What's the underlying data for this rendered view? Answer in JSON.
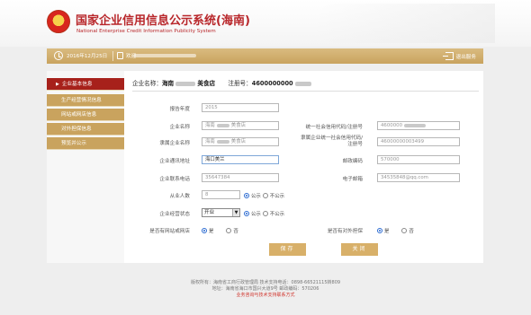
{
  "header": {
    "title_cn": "国家企业信用信息公示系统(海南)",
    "title_en": "National Enterprise Credit Information Publicity System"
  },
  "topbar": {
    "date": "2016年12月25日",
    "user_prefix": "欢迎",
    "logout_label": "退出服务"
  },
  "sidebar": {
    "items": [
      {
        "label": "企业基本信息",
        "active": true
      },
      {
        "label": "生产经营情况信息",
        "active": false
      },
      {
        "label": "网站或网店信息",
        "active": false
      },
      {
        "label": "对外担保信息",
        "active": false
      },
      {
        "label": "预览并公示",
        "active": false
      }
    ]
  },
  "company": {
    "name_label": "企业名称：",
    "name_value": "海南",
    "name_suffix": "美食店",
    "reg_label": "注册号：",
    "reg_value": "4600000000"
  },
  "form": {
    "report_year_label": "报告年度",
    "report_year_value": "2015",
    "ent_name_label": "企业名称",
    "ent_name_value": "海南",
    "ent_name_suffix": "美食店",
    "credit_code_label": "统一社会信用代码/注册号",
    "credit_code_value": "4600000",
    "affiliated_name_label": "隶属企业名称",
    "affiliated_name_value": "海南",
    "affiliated_name_suffix": "美食店",
    "affiliated_code_label": "隶属企业统一社会信用代码/注册号",
    "affiliated_code_value": "4600000000",
    "affiliated_code_suffix": "3499",
    "address_label": "企业通讯地址",
    "address_value": "海口美兰",
    "postcode_label": "邮政编码",
    "postcode_value": "570000",
    "phone_label": "企业联系电话",
    "phone_value": "35647384",
    "email_label": "电子邮箱",
    "email_value": "34535848@qq.com",
    "employees_label": "从业人数",
    "employees_value": "8",
    "publish_label": "公示",
    "nopublish_label": "不公示",
    "status_label": "企业经营状态",
    "status_value": "开业",
    "website_label": "是否有网站或网店",
    "guarantee_label": "是否有对外担保",
    "yes_label": "是",
    "no_label": "否",
    "save_label": "保存",
    "close_label": "关闭"
  },
  "footer": {
    "line1": "版权所有：海南省工商行政管理局  技术支持电话：0898-66521115转809",
    "line2": "地址：海南省海口市国兴大道9号  邮政编码：570206",
    "line3": "业务咨询与技术支持联系方式"
  },
  "colors": {
    "brand_red": "#b8262a",
    "gold": "#c9a35e",
    "active_red": "#a7211b"
  }
}
